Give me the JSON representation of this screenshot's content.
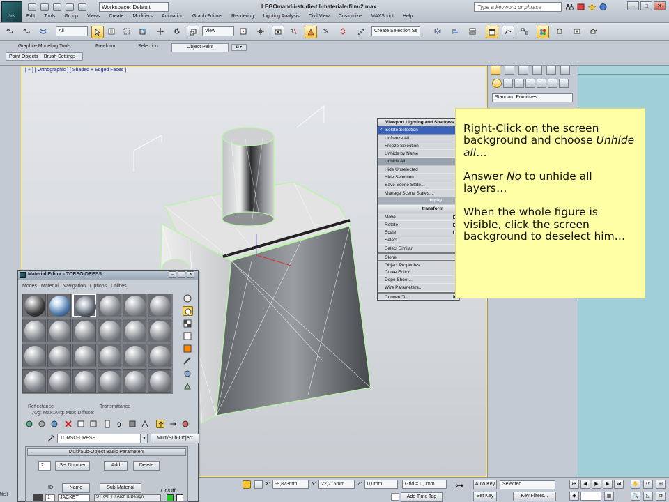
{
  "app": {
    "logo_text": "3ds",
    "workspace": "Workspace: Default",
    "window_title": "LEGOmand-i-studie-til-materiale-film-2.max",
    "search_placeholder": "Type a keyword or phrase",
    "win_minimize": "–",
    "win_maximize": "□",
    "win_close": "✕"
  },
  "menu": [
    "Edit",
    "Tools",
    "Group",
    "Views",
    "Create",
    "Modifiers",
    "Animation",
    "Graph Editors",
    "Rendering",
    "Lighting Analysis",
    "Civil View",
    "Customize",
    "MAXScript",
    "Help"
  ],
  "toolbar": {
    "selection_filter": "All",
    "ref_coord": "View",
    "named_selection": "Create Selection Se"
  },
  "ribbon": {
    "tabs": [
      "Graphite Modeling Tools",
      "Freeform",
      "Selection",
      "Object Paint"
    ],
    "active_tab": "Object Paint",
    "toggle": "◘ ▾",
    "subtabs": [
      "Paint Objects",
      "Brush Settings"
    ]
  },
  "viewport": {
    "label": "[ + ] [ Orthographic ] [ Shaded + Edged Faces ]"
  },
  "quad_menu": {
    "top_header": "Viewport Lighting and Shadows",
    "items": [
      {
        "label": "Isolate Selection",
        "state": "sel",
        "check": "✓"
      },
      {
        "label": "Unfreeze All"
      },
      {
        "label": "Freeze Selection"
      },
      {
        "label": "Unhide by Name"
      },
      {
        "label": "Unhide All",
        "state": "hover"
      },
      {
        "label": "Hide Unselected"
      },
      {
        "label": "Hide Selection"
      },
      {
        "label": "Save Scene State..."
      },
      {
        "label": "Manage Scene States..."
      }
    ],
    "display_header": "display",
    "transform_header": "transform",
    "transform_items": [
      {
        "label": "Move",
        "box": true
      },
      {
        "label": "Rotate",
        "box": true
      },
      {
        "label": "Scale",
        "box": true
      },
      {
        "label": "Select"
      },
      {
        "label": "Select Similar"
      },
      {
        "label": "Clone",
        "sep": true
      },
      {
        "label": "Object Properties...",
        "sep": true
      },
      {
        "label": "Curve Editor..."
      },
      {
        "label": "Dope Sheet..."
      },
      {
        "label": "Wire Parameters..."
      },
      {
        "label": "Convert To:",
        "arrow": "▶",
        "sep": true
      }
    ]
  },
  "command_panel": {
    "category_dropdown": "Standard Primitives"
  },
  "note": {
    "p1_text": "Right-Click on the screen background and choose ",
    "p1_em": "Unhide all",
    "p1_tail": "…",
    "p2_text": "Answer ",
    "p2_em": "No",
    "p2_tail": " to unhide all layers…",
    "p3": "When the whole figure is visible, click the screen background to deselect him…"
  },
  "material_editor": {
    "title": "Material Editor - TORSO-DRESS",
    "menu": [
      "Modes",
      "Material",
      "Navigation",
      "Options",
      "Utilities"
    ],
    "reflectance": "Reflectance",
    "transmittance": "Transmittance",
    "avg_max_row": "Avg:      Max:                Avg:      Max:      Diffuse:",
    "material_name": "TORSO-DRESS",
    "material_type": "Multi/Sub-Object",
    "rollout_title": "Multi/Sub-Object Basic Parameters",
    "rollout_minus": "-",
    "count": "2",
    "set_number": "Set Number",
    "add": "Add",
    "delete": "Delete",
    "col_id": "ID",
    "col_name": "Name",
    "col_submaterial": "Sub-Material",
    "col_onoff": "On/Off",
    "row1_id": "1",
    "row1_name": "JACKET",
    "row1_sub": "STRAIFF / Arch & Design"
  },
  "status": {
    "x_label": "X:",
    "x_val": "-9,873mm",
    "y_label": "Y:",
    "y_val": "22,215mm",
    "z_label": "Z:",
    "z_val": "0,0mm",
    "grid": "Grid = 0,0mm",
    "key_icon": "⊶",
    "auto_key": "Auto Key",
    "set_key": "Set Key",
    "selected": "Selected",
    "key_filters": "Key Filters...",
    "add_time_tag": "Add Time Tag",
    "welcome": "Wel"
  },
  "colors": {
    "note_bg": "#ffffa6",
    "quad_selected": "#3b62b6",
    "viewport_border": "#f6e58a"
  }
}
